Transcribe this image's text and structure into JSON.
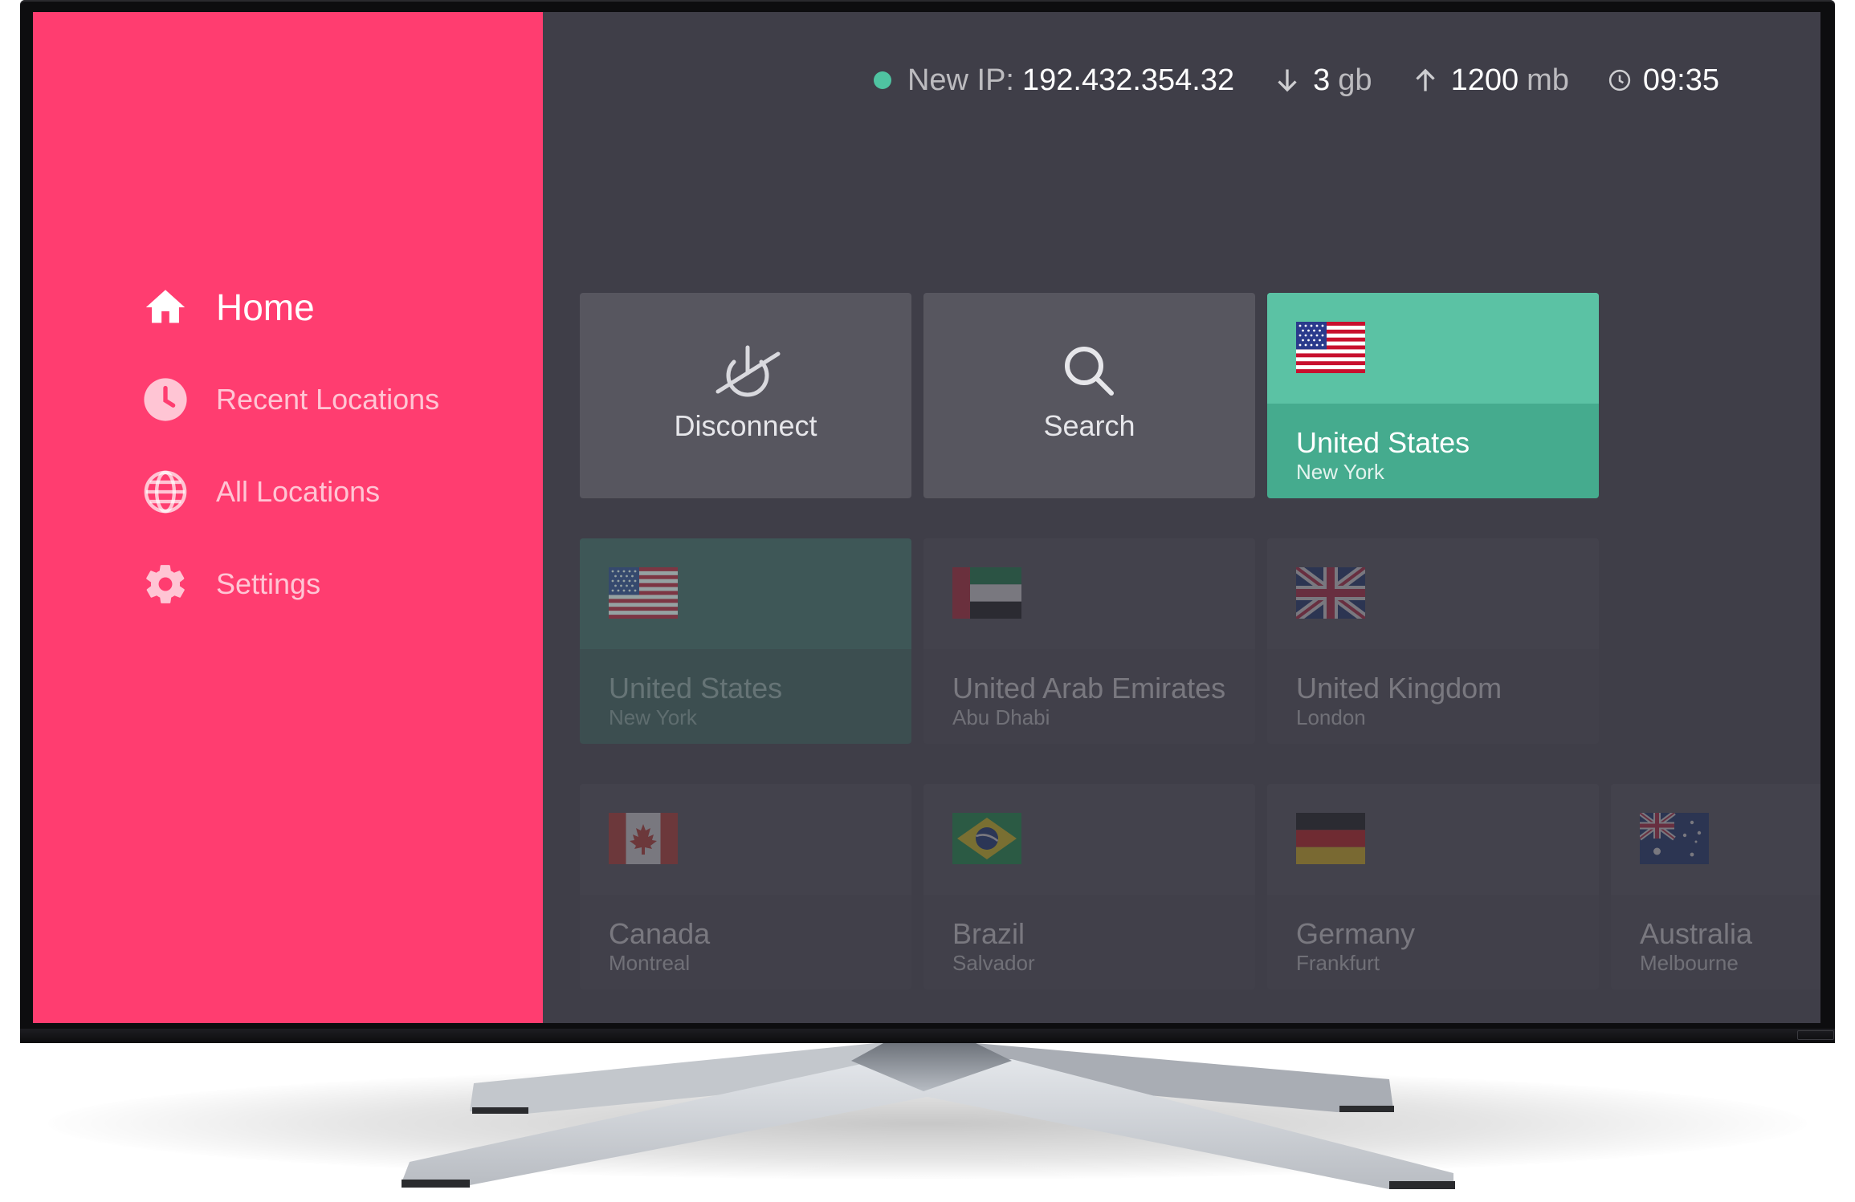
{
  "sidebar": {
    "items": [
      {
        "label": "Home",
        "icon": "home-icon",
        "active": true
      },
      {
        "label": "Recent Locations",
        "icon": "clock-icon",
        "active": false
      },
      {
        "label": "All Locations",
        "icon": "globe-icon",
        "active": false
      },
      {
        "label": "Settings",
        "icon": "gear-icon",
        "active": false
      }
    ]
  },
  "status": {
    "ip_label": "New IP:",
    "ip_value": "192.432.354.32",
    "download_value": "3",
    "download_unit": "gb",
    "upload_value": "1200",
    "upload_unit": "mb",
    "time": "09:35"
  },
  "actions": {
    "disconnect_label": "Disconnect",
    "search_label": "Search"
  },
  "featured": {
    "country": "United States",
    "city": "New York",
    "flag": "us-flag"
  },
  "locations": [
    {
      "country": "United States",
      "city": "New York",
      "flag": "us-flag"
    },
    {
      "country": "United Arab Emirates",
      "city": "Abu Dhabi",
      "flag": "uae-flag"
    },
    {
      "country": "United Kingdom",
      "city": "London",
      "flag": "uk-flag"
    },
    {
      "country": "Canada",
      "city": "Montreal",
      "flag": "canada-flag"
    },
    {
      "country": "Brazil",
      "city": "Salvador",
      "flag": "brazil-flag"
    },
    {
      "country": "Germany",
      "city": "Frankfurt",
      "flag": "germany-flag"
    },
    {
      "country": "Australia",
      "city": "Melbourne",
      "flag": "australia-flag"
    }
  ],
  "colors": {
    "sidebar": "#ff3d70",
    "screen_bg": "#3f3e48",
    "accent_green": "#5bc2a4",
    "status_dot": "#4fc3a1"
  }
}
